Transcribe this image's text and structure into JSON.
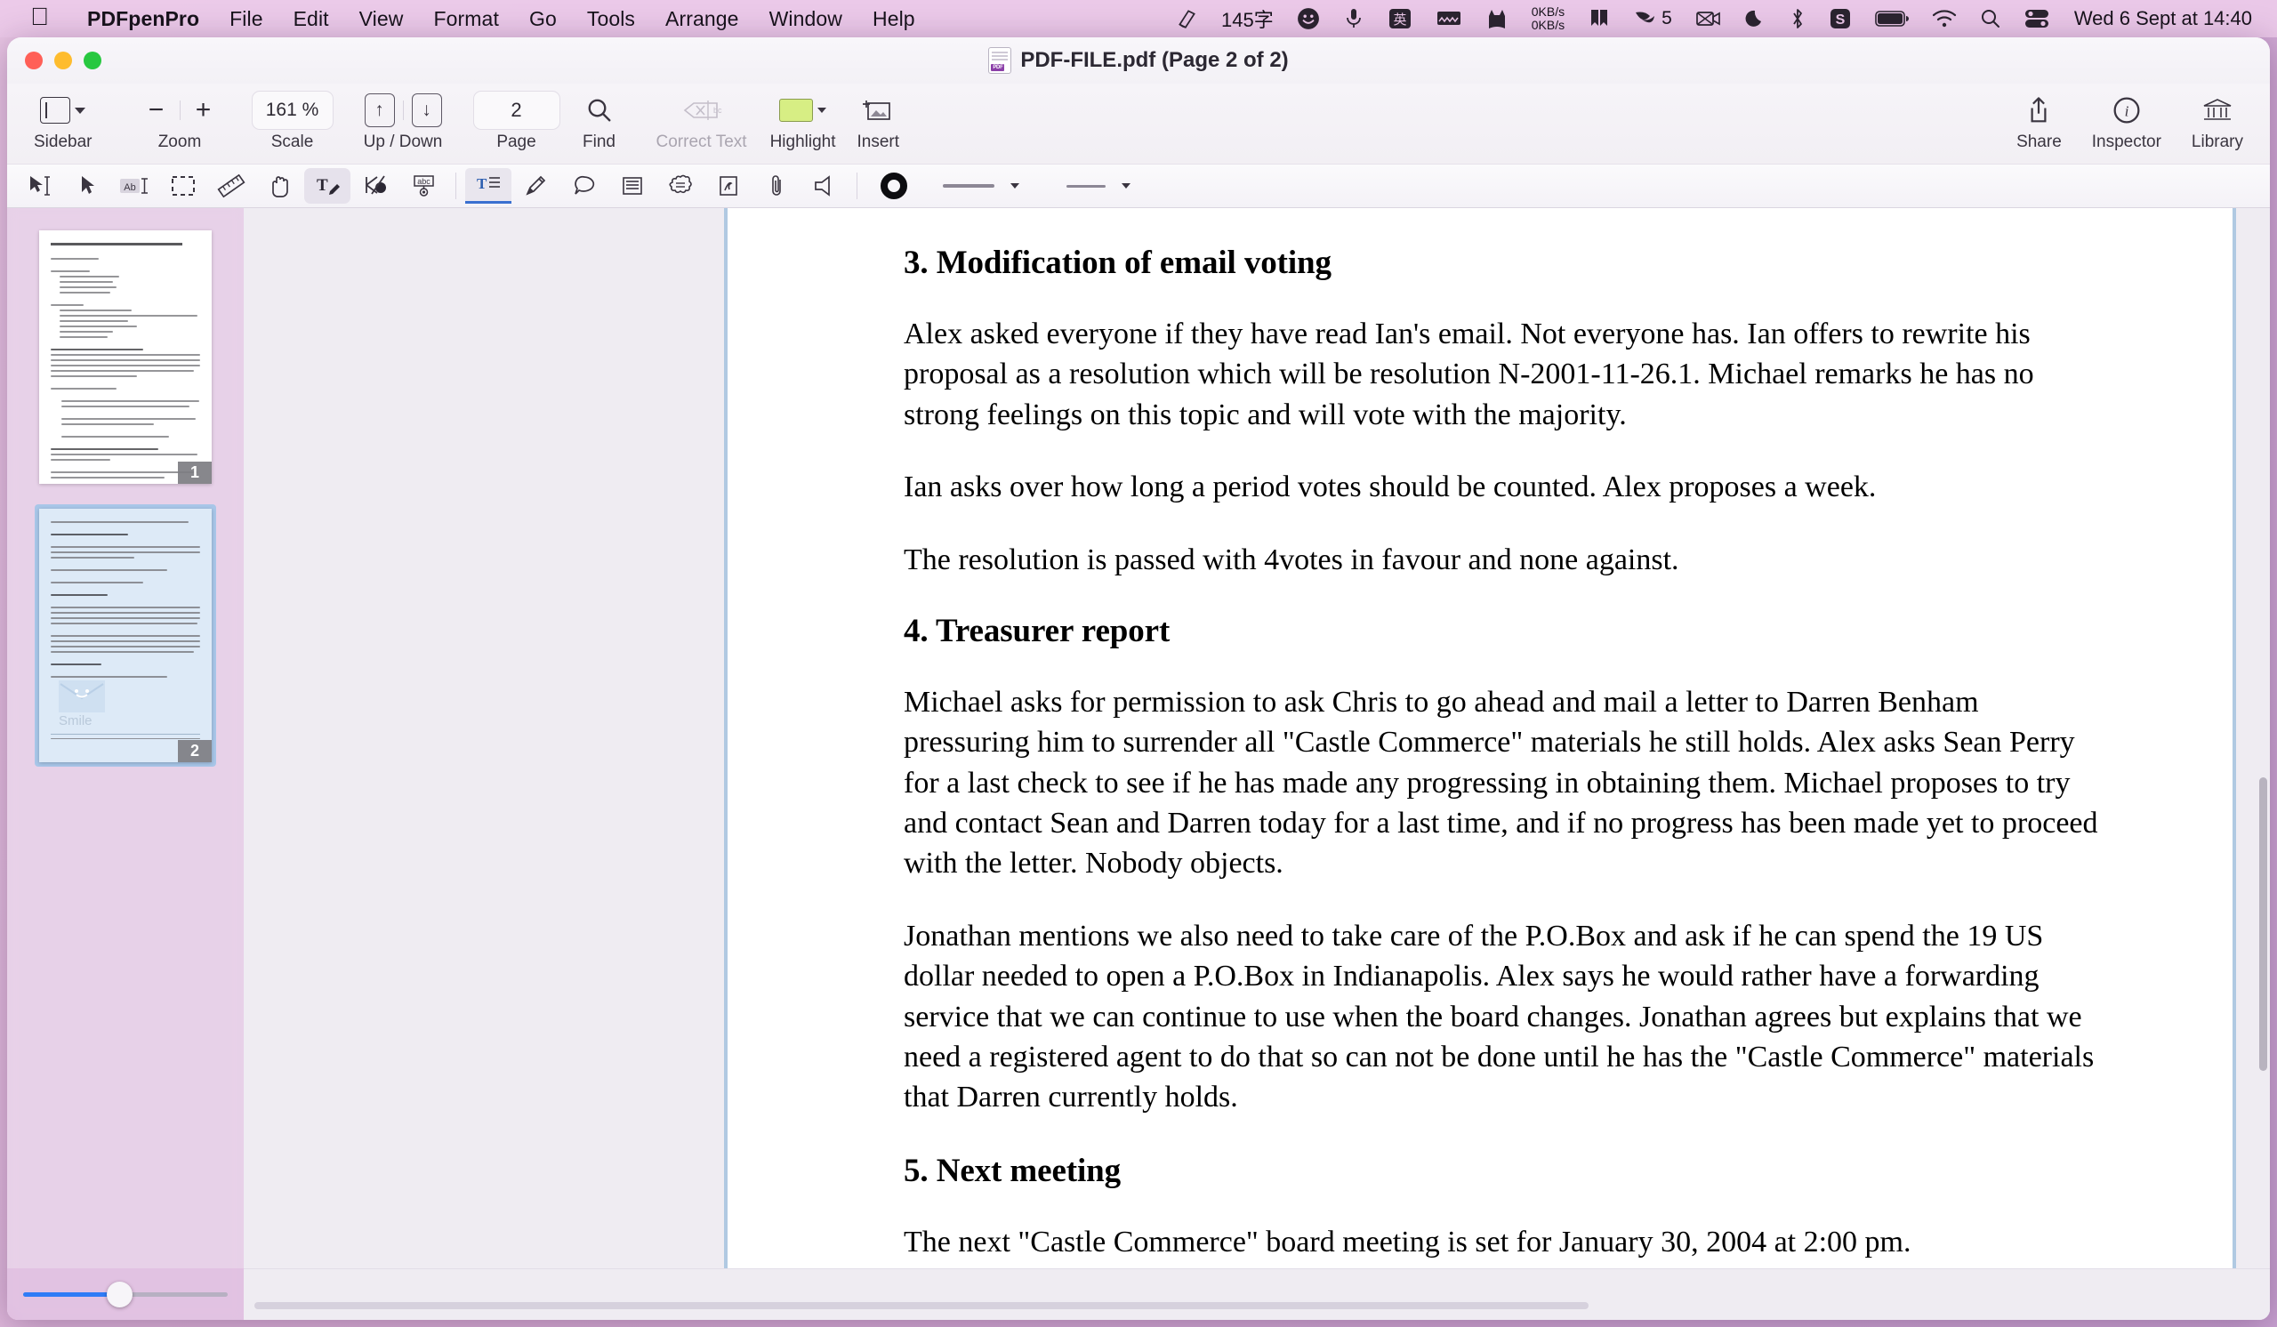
{
  "menubar": {
    "apple_icon": "apple-icon",
    "app_name": "PDFpenPro",
    "items": [
      "File",
      "Edit",
      "View",
      "Format",
      "Go",
      "Tools",
      "Arrange",
      "Window",
      "Help"
    ],
    "status": {
      "clipboard_icon": "clipboard-icon",
      "char_count": "145字",
      "smiley_icon": "smiley-face-icon",
      "mic_icon": "microphone-icon",
      "input_source": "英",
      "keyboard_icon": "keyboard-icon",
      "cat_icon": "cat-icon",
      "network_up": "0KB/s",
      "network_down": "0KB/s",
      "grid_icon": "grid-bookmark-icon",
      "leaf_icon": "leaf-icon",
      "leaf_badge": "5",
      "screen_record_icon": "screen-record-icon",
      "moon_icon": "moon-icon",
      "bluetooth_icon": "bluetooth-icon",
      "s_app_icon": "s-app-icon",
      "battery_icon": "battery-icon",
      "wifi_icon": "wifi-icon",
      "search_icon": "spotlight-search-icon",
      "control_center_icon": "control-center-icon",
      "clock": "Wed 6 Sept at  14:40"
    }
  },
  "window": {
    "title": "PDF-FILE.pdf (Page 2 of 2)",
    "doc_icon": "pdf-document-icon",
    "traffic": {
      "close": "close-button",
      "minimize": "minimize-button",
      "zoom": "zoom-button"
    }
  },
  "toolbar": {
    "sidebar": {
      "label": "Sidebar",
      "icon": "sidebar-panel-icon"
    },
    "zoom": {
      "label": "Zoom",
      "out_icon": "minus-icon",
      "in_icon": "plus-icon",
      "minus": "−",
      "plus": "+"
    },
    "scale": {
      "label": "Scale",
      "value": "161 %"
    },
    "updown": {
      "label": "Up / Down",
      "up": "↑",
      "down": "↓"
    },
    "page": {
      "label": "Page",
      "value": "2"
    },
    "find": {
      "label": "Find",
      "icon": "magnifier-icon"
    },
    "correct_text": {
      "label": "Correct Text",
      "icon": "correct-text-icon",
      "disabled": true
    },
    "highlight": {
      "label": "Highlight",
      "icon": "highlight-swatch-icon",
      "color": "#d7ee84"
    },
    "insert": {
      "label": "Insert",
      "icon": "insert-image-icon"
    },
    "share": {
      "label": "Share",
      "icon": "share-icon"
    },
    "inspector": {
      "label": "Inspector",
      "icon": "info-circle-icon"
    },
    "library": {
      "label": "Library",
      "icon": "library-columns-icon"
    }
  },
  "annotation_bar": {
    "tools": [
      {
        "name": "select-text-tool-icon"
      },
      {
        "name": "arrow-select-tool-icon"
      },
      {
        "name": "edit-text-block-tool-icon"
      },
      {
        "name": "rectangle-select-tool-icon"
      },
      {
        "name": "ruler-tool-icon"
      },
      {
        "name": "hand-scroll-tool-icon"
      },
      {
        "name": "edit-text-tool-icon",
        "active": true
      },
      {
        "name": "redact-tool-icon"
      },
      {
        "name": "ocr-text-tool-icon"
      },
      {
        "name": "text-field-tool-icon",
        "active": true
      },
      {
        "name": "pencil-markup-tool-icon"
      },
      {
        "name": "comment-bubble-tool-icon"
      },
      {
        "name": "text-box-tool-icon"
      },
      {
        "name": "cloud-shape-tool-icon"
      },
      {
        "name": "signature-tool-icon"
      },
      {
        "name": "attachment-tool-icon"
      },
      {
        "name": "sound-note-tool-icon"
      }
    ],
    "stroke_color_icon": "stroke-color-ring-icon",
    "line_width_icon": "line-width-picker-icon",
    "line_style_icon": "line-style-picker-icon"
  },
  "sidebar": {
    "thumbnails": [
      {
        "page_number": "1",
        "selected": false
      },
      {
        "page_number": "2",
        "selected": true,
        "watermark": "Smile"
      }
    ],
    "thumb_size_slider": {
      "name": "thumbnail-size-slider",
      "value": 41
    }
  },
  "document": {
    "blocks": [
      {
        "type": "heading",
        "text": "3. Modification of email voting"
      },
      {
        "type": "paragraph",
        "text": "Alex asked everyone if they have read Ian's email. Not everyone has. Ian offers to rewrite his proposal as a resolution which will be resolution N-2001-11-26.1. Michael remarks he has no strong feelings on this topic and will vote with the majority."
      },
      {
        "type": "paragraph",
        "text": "Ian asks over how long a period votes should be counted. Alex proposes a week."
      },
      {
        "type": "paragraph",
        "text": "The resolution is passed with 4votes in favour and none against."
      },
      {
        "type": "heading",
        "text": "4. Treasurer report"
      },
      {
        "type": "paragraph",
        "text": "Michael asks for permission to ask Chris to go ahead and mail a letter to Darren Benham pressuring him to surrender all \"Castle Commerce\" materials he still holds. Alex asks Sean Perry for a last check to see if he has made any progressing in obtaining them. Michael proposes to try and contact Sean and Darren today for a last time, and if no progress has been made yet to proceed with the letter. Nobody objects."
      },
      {
        "type": "paragraph",
        "text": "Jonathan mentions we also need to take care of the P.O.Box and ask if he can spend the 19 US dollar needed to open a P.O.Box in Indianapolis. Alex says he would rather have a forwarding service that we can continue to use when the board changes. Jonathan agrees but explains that we need a registered agent to do that so can not be done until he has the \"Castle Commerce\" materials that Darren currently holds."
      },
      {
        "type": "heading",
        "text": "5. Next meeting"
      },
      {
        "type": "paragraph",
        "text": "The next \"Castle Commerce\" board meeting is set for January 30, 2004 at 2:00 pm."
      }
    ]
  },
  "colors": {
    "desktop": "#d9b0d6",
    "menubar": "#ecc9e9",
    "window_chrome": "#f2eff4",
    "highlight_yellow": "#d7ee84",
    "selection_blue": "#a8c6e8",
    "slider_blue": "#2f7cf6",
    "page_border": "#b0c9e2"
  }
}
